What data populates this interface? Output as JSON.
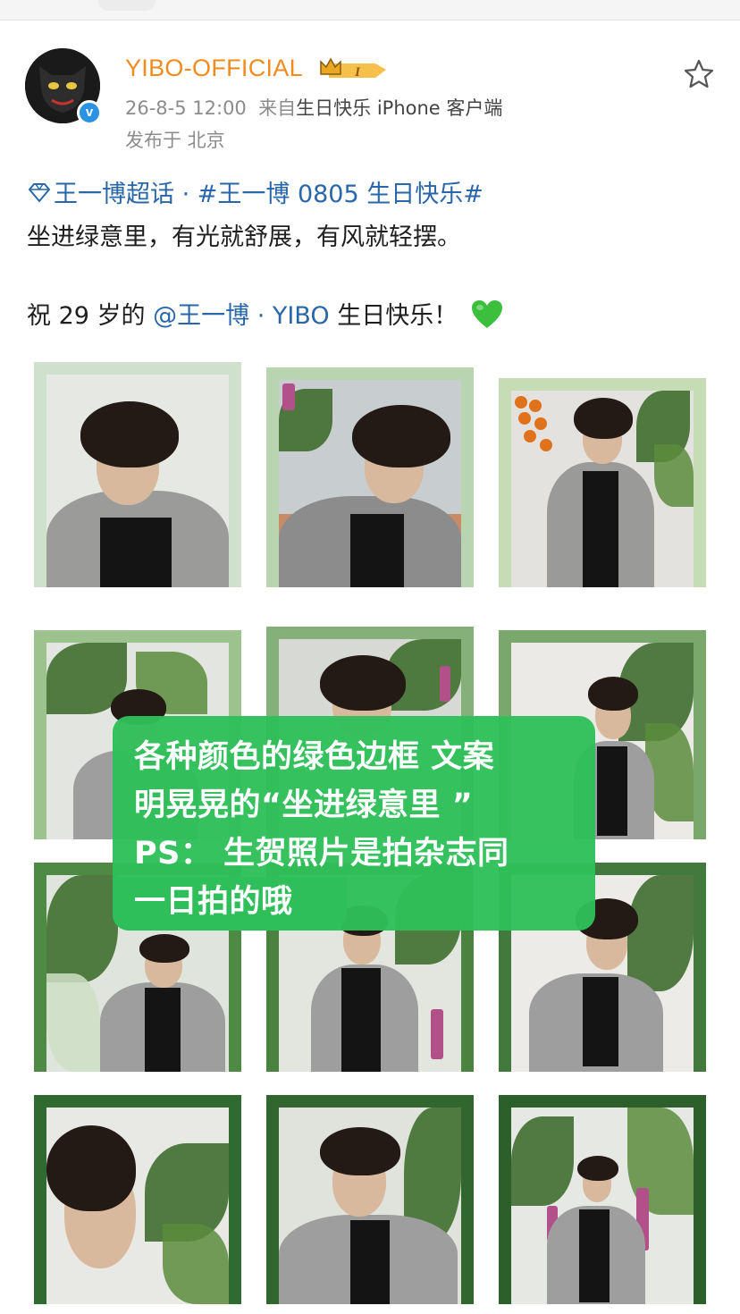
{
  "post": {
    "username": "YIBO-OFFICIAL",
    "level_badge": "I",
    "timestamp": "26-8-5 12:00",
    "source_prefix": "来自",
    "source": "生日快乐 iPhone 客户端",
    "location": "发布于 北京",
    "verified_mark": "v",
    "line1_topic": "王一博超话",
    "line1_sep": " · ",
    "line1_hashtag": "#王一博 0805 生日快乐#",
    "line2": "坐进绿意里，有光就舒展，有风就轻摆。",
    "line3_prefix": "祝 29 岁的 ",
    "line3_mention": "@王一博 · YIBO",
    "line3_suffix": " 生日快乐！",
    "icons": [
      "avatar-panther",
      "verified-icon",
      "crown-badge-icon",
      "star-icon",
      "diamond-topic-icon",
      "green-heart-icon"
    ]
  },
  "overlay": {
    "line1": "各种颜色的绿色边框 文案",
    "line2": "明晃晃的“坐进绿意里 ”",
    "line3": "PS： 生贺照片是拍杂志同",
    "line4": "一日拍的哦",
    "color": "#2fbf5a"
  },
  "grid": {
    "frames": [
      "#cfe0cc",
      "#b9d5b0",
      "#c6dcb4",
      "#9cc28e",
      "#86b079",
      "#79a76c",
      "#4f8a45",
      "#4a8340",
      "#417a3c",
      "#2f6a31",
      "#31662f",
      "#2d5f2b"
    ]
  }
}
